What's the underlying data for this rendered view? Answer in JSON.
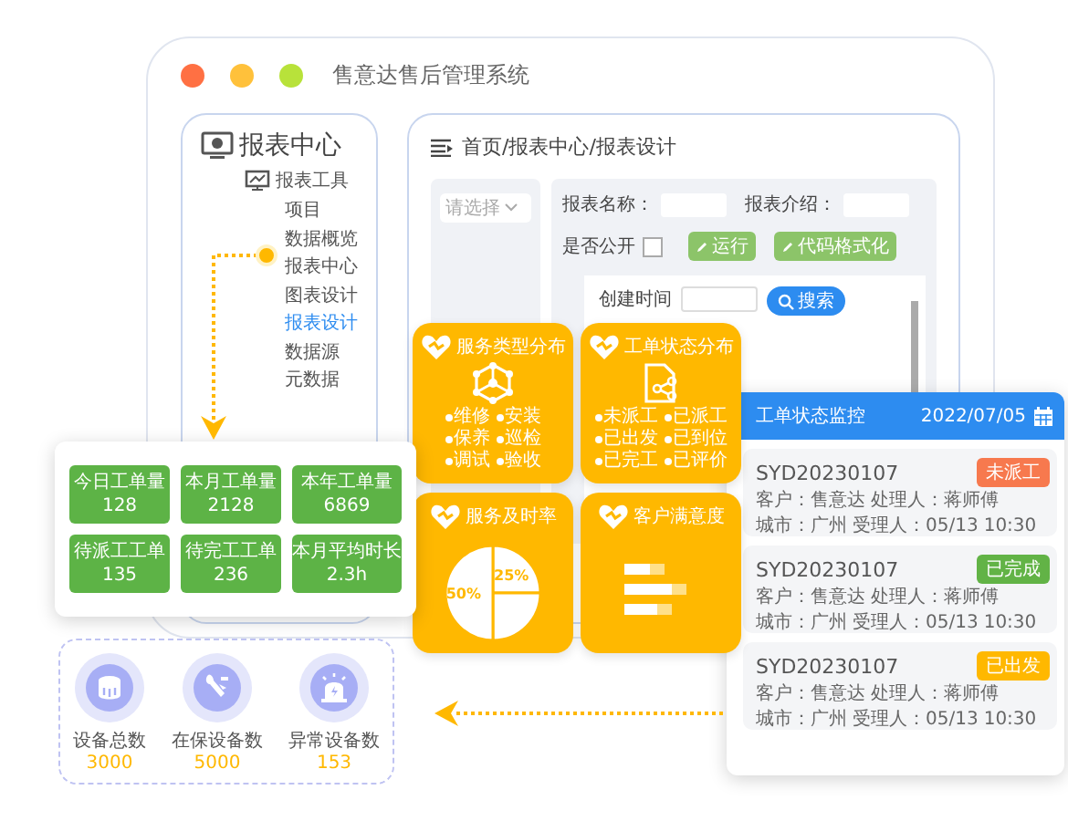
{
  "window": {
    "title": "售意达售后管理系统"
  },
  "sidebar": {
    "title": "报表中心",
    "group": "报表工具",
    "items": [
      {
        "label": "项目",
        "selected": false
      },
      {
        "label": "数据概览",
        "selected": false
      },
      {
        "label": "报表中心",
        "selected": false
      },
      {
        "label": "图表设计",
        "selected": false
      },
      {
        "label": "报表设计",
        "selected": true
      },
      {
        "label": "数据源",
        "selected": false
      },
      {
        "label": "元数据",
        "selected": false
      }
    ]
  },
  "breadcrumb": "首页/报表中心/报表设计",
  "filter": {
    "placeholder": "请选择"
  },
  "form": {
    "fields": [
      {
        "label": "报表名称："
      },
      {
        "label": "报表介绍："
      }
    ],
    "public": {
      "label": "是否公开",
      "checked": false
    },
    "buttons": [
      "运行",
      "代码格式化"
    ],
    "search_panel": {
      "label": "创建时间",
      "button": "搜索"
    }
  },
  "cards": [
    {
      "kind": "types",
      "title": "服务类型分布",
      "items": [
        "维修",
        "安装",
        "保养",
        "巡检",
        "调试",
        "验收"
      ]
    },
    {
      "kind": "statuses",
      "title": "工单状态分布",
      "items": [
        "未派工",
        "已派工",
        "已出发",
        "已到位",
        "已完工",
        "已评价"
      ]
    },
    {
      "kind": "pie",
      "title": "服务及时率",
      "chart_data": {
        "type": "pie",
        "values": [
          25,
          25,
          50
        ],
        "value_labels": [
          "25%",
          null,
          "50%"
        ]
      }
    },
    {
      "kind": "bars",
      "title": "客户满意度"
    }
  ],
  "stats": [
    {
      "label": "今日工单量",
      "value": "128"
    },
    {
      "label": "本月工单量",
      "value": "2128"
    },
    {
      "label": "本年工单量",
      "value": "6869"
    },
    {
      "label": "待派工工单",
      "value": "135"
    },
    {
      "label": "待完工工单",
      "value": "236"
    },
    {
      "label": "本月平均时长",
      "value": "2.3h"
    }
  ],
  "monitor": {
    "title": "工单状态监控",
    "date": "2022/07/05",
    "orders": [
      {
        "id": "SYD20230107",
        "status": "未派工",
        "color": "#f7794e",
        "customer": "客户：售意达",
        "handler": "处理人：蒋师傅",
        "city": "城市：广州",
        "acceptor": "受理人：05/13",
        "time": "10:30"
      },
      {
        "id": "SYD20230107",
        "status": "已完成",
        "color": "#62b346",
        "customer": "客户：售意达",
        "handler": "处理人：蒋师傅",
        "city": "城市：广州",
        "acceptor": "受理人：05/13",
        "time": "10:30"
      },
      {
        "id": "SYD20230107",
        "status": "已出发",
        "color": "#ffb800",
        "customer": "客户：售意达",
        "handler": "处理人：蒋师傅",
        "city": "城市：广州",
        "acceptor": "受理人：05/13",
        "time": "10:30"
      }
    ]
  },
  "devices": [
    {
      "kind": "total",
      "label": "设备总数",
      "value": "3000"
    },
    {
      "kind": "warranty",
      "label": "在保设备数",
      "value": "5000"
    },
    {
      "kind": "alarm",
      "label": "异常设备数",
      "value": "153"
    }
  ]
}
